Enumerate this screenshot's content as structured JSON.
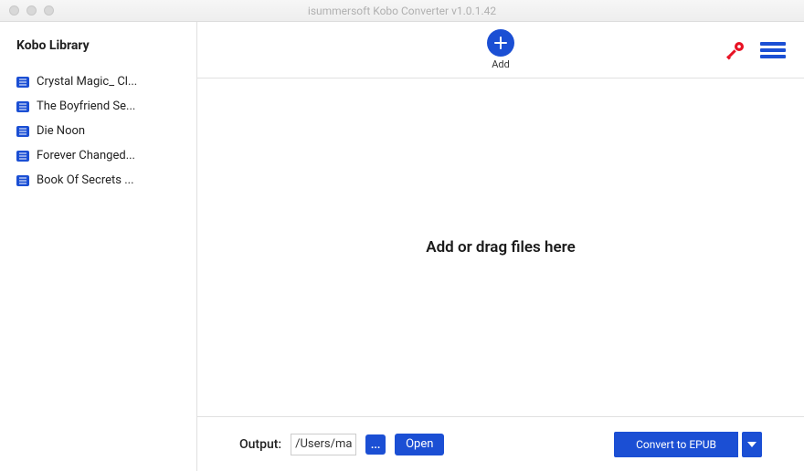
{
  "window": {
    "title": "isummersoft Kobo Converter v1.0.1.42"
  },
  "sidebar": {
    "title": "Kobo Library",
    "items": [
      {
        "label": "Crystal Magic_ Cl..."
      },
      {
        "label": "The Boyfriend Se..."
      },
      {
        "label": "Die Noon"
      },
      {
        "label": "Forever Changed..."
      },
      {
        "label": "Book Of Secrets ..."
      }
    ]
  },
  "toolbar": {
    "add_label": "Add"
  },
  "main": {
    "drop_text": "Add or drag files here"
  },
  "bottom": {
    "output_label": "Output:",
    "output_path": "/Users/ma",
    "browse_label": "...",
    "open_label": "Open",
    "convert_label": "Convert to EPUB"
  }
}
